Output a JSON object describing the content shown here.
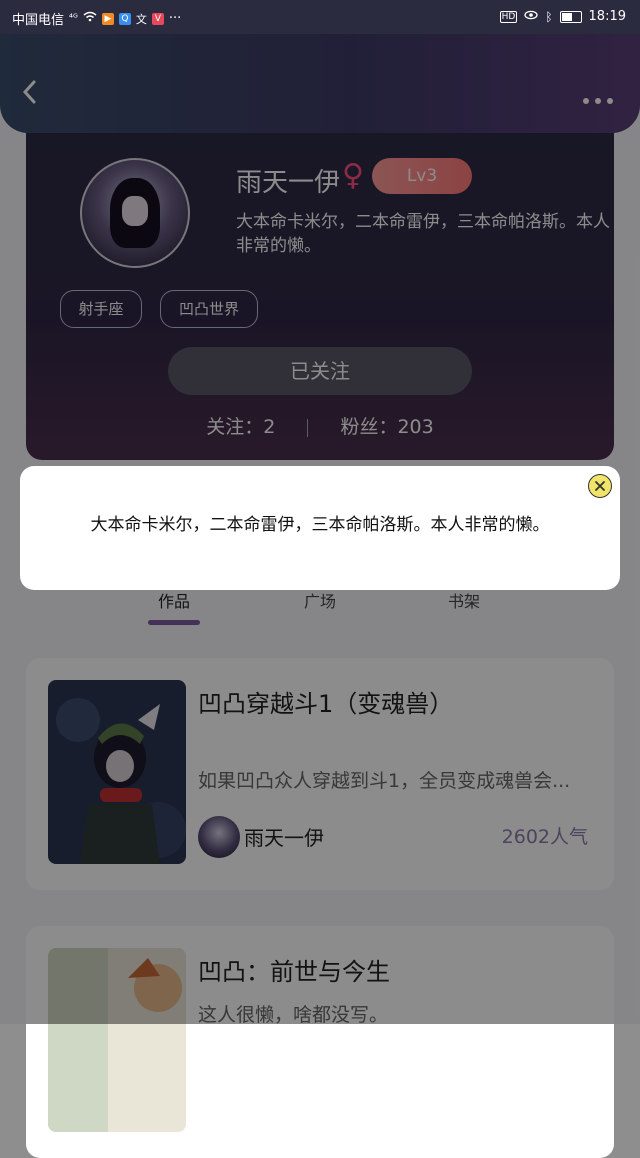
{
  "status_bar": {
    "carrier": "中国电信",
    "signal": "⁴ᴳ",
    "time": "18:19"
  },
  "header": {
    "back_icon": "chevron-left-icon",
    "more_icon": "more-dots-icon"
  },
  "profile": {
    "username": "雨天一伊",
    "gender_symbol": "♀",
    "level": "Lv3",
    "bio": "大本命卡米尔，二本命雷伊，三本命帕洛斯。本人非常的懒。",
    "tags": [
      "射手座",
      "凹凸世界"
    ],
    "follow_button": "已关注",
    "following_label": "关注：",
    "following_count": "2",
    "fans_label": "粉丝：",
    "fans_count": "203"
  },
  "tabs": {
    "items": [
      "作品",
      "广场",
      "书架"
    ],
    "active": 0
  },
  "works": [
    {
      "title": "凹凸穿越斗1（变魂兽）",
      "desc": "如果凹凸众人穿越到斗1，全员变成魂兽会...",
      "author": "雨天一伊",
      "popularity": "2602人气"
    },
    {
      "title": "凹凸：前世与今生",
      "desc": "这人很懒，啥都没写。"
    }
  ],
  "dialog": {
    "text": "大本命卡米尔，二本命雷伊，三本命帕洛斯。本人非常的懒。",
    "close_icon": "close-circle-icon"
  },
  "colors": {
    "header_gradient_start": "#3a4d6c",
    "header_gradient_end": "#5a3e78",
    "level_badge": "#ff8a8a",
    "gender": "#ff4f80",
    "tab_indicator": "#7a5aa0"
  }
}
